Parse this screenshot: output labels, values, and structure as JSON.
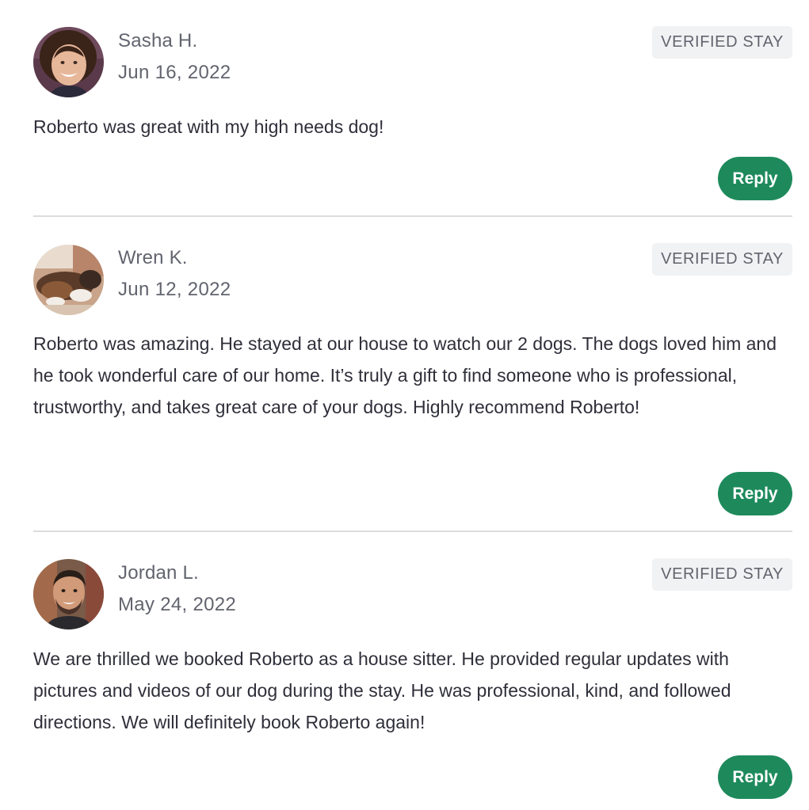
{
  "reviews": [
    {
      "name": "Sasha H.",
      "date": "Jun 16, 2022",
      "badge": "VERIFIED STAY",
      "text": "Roberto was great with my high needs dog!",
      "reply_label": "Reply"
    },
    {
      "name": "Wren K.",
      "date": "Jun 12, 2022",
      "badge": "VERIFIED STAY",
      "text": "Roberto was amazing. He stayed at our house to watch our 2 dogs. The dogs loved him and he took wonderful care of our home. It’s truly a gift to find someone who is professional, trustworthy, and takes great care of your dogs. Highly recommend Roberto!",
      "reply_label": "Reply"
    },
    {
      "name": "Jordan L.",
      "date": "May 24, 2022",
      "badge": "VERIFIED STAY",
      "text": "We are thrilled we booked Roberto as a house sitter. He provided regular updates with pictures and videos of our dog during the stay. He was professional, kind, and followed directions. We will definitely book Roberto again!",
      "reply_label": "Reply"
    }
  ],
  "colors": {
    "reply_button": "#1e8a5c",
    "badge_background": "#f1f2f4",
    "divider": "#dcdcde",
    "muted_text": "#62646e",
    "body_text": "#2f2f3a"
  }
}
